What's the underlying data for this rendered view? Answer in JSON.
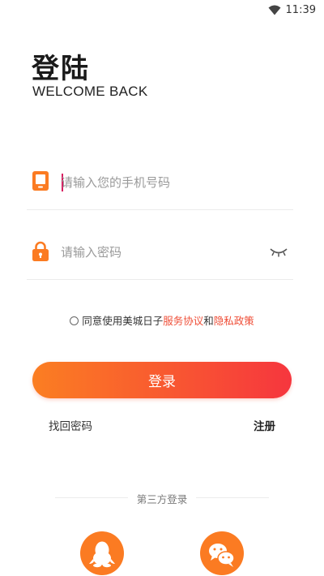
{
  "status_bar": {
    "time": "11:39",
    "icons": [
      "wifi-icon"
    ]
  },
  "header": {
    "title": "登陆",
    "subtitle": "WELCOME BACK"
  },
  "form": {
    "phone": {
      "placeholder": "请输入您的手机号码",
      "value": "",
      "icon": "phone-icon"
    },
    "password": {
      "placeholder": "请输入密码",
      "value": "",
      "icon": "lock-icon",
      "toggle_icon": "eye-closed-icon"
    }
  },
  "agreement": {
    "prefix": "同意使用美城日子",
    "service_link": "服务协议",
    "conjunction": "和",
    "privacy_link": "隐私政策",
    "checked": false
  },
  "actions": {
    "login_label": "登录",
    "forgot_label": "找回密码",
    "register_label": "注册"
  },
  "third_party": {
    "label": "第三方登录",
    "providers": [
      "qq-icon",
      "wechat-icon"
    ]
  },
  "colors": {
    "accent_start": "#fb7e22",
    "accent_end": "#f6363e",
    "link": "#ef4e37",
    "icon": "#fb7b22"
  }
}
